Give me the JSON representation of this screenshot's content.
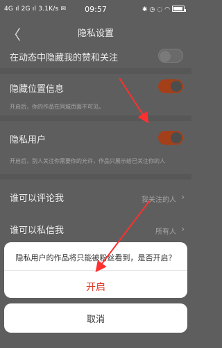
{
  "status_bar": {
    "left": "4G ıl 2G ıl 3.1K/s ✉",
    "time": "09:57",
    "right_icons": [
      "bluetooth-icon",
      "alarm-icon",
      "mute-icon",
      "wifi-icon"
    ],
    "battery_level": 0.9
  },
  "header": {
    "back_glyph": "〈",
    "title": "隐私设置"
  },
  "settings": {
    "hide_likes": {
      "label": "在动态中隐藏我的赞和关注",
      "enabled": false
    },
    "hide_location": {
      "label": "隐藏位置信息",
      "enabled": true,
      "desc": "开启后，你的作品在同城页面不可见。"
    },
    "private_user": {
      "label": "隐私用户",
      "enabled": true,
      "desc": "开启后，别人关注你需要你的允许，作品只展示给已关注你的人"
    },
    "who_comment": {
      "label": "谁可以评论我",
      "value": "我关注的人"
    },
    "who_message": {
      "label": "谁可以私信我",
      "value": "所有人"
    }
  },
  "dialog": {
    "message": "隐私用户的作品将只能被粉丝看到，是否开启？",
    "enable_label": "开启",
    "cancel_label": "取消"
  },
  "colors": {
    "accent": "#e0331f",
    "toggle_on": "#a3401a",
    "annotation_arrow": "#ff3030"
  }
}
